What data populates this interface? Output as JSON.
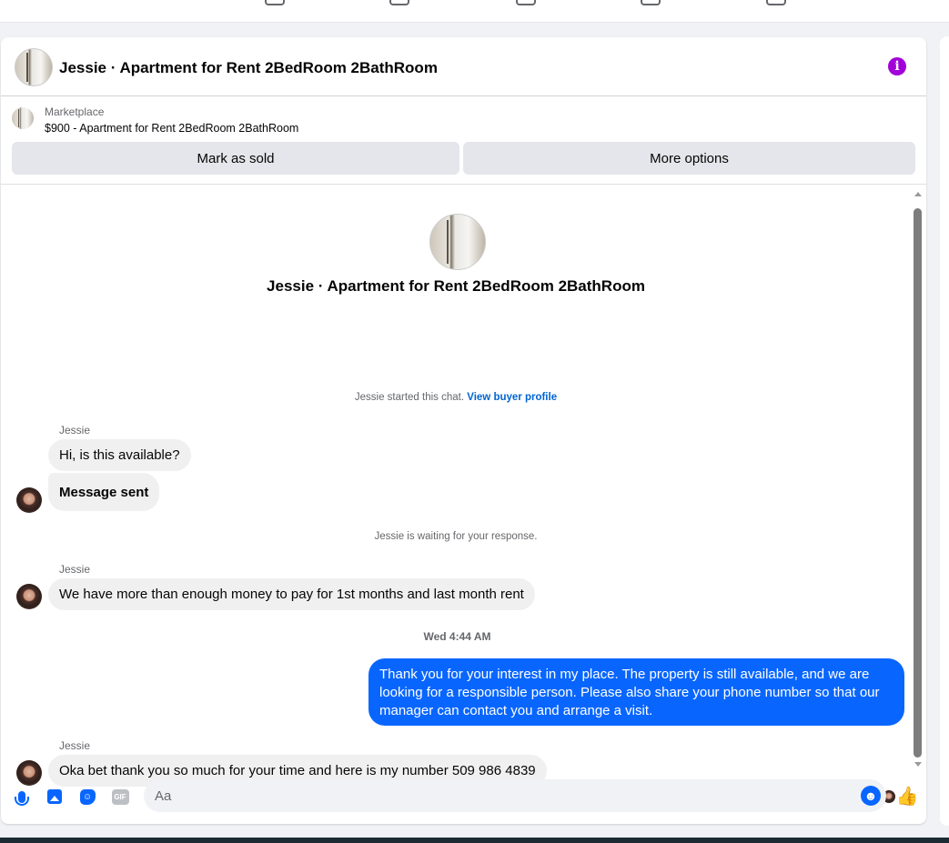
{
  "header": {
    "title": "Jessie · Apartment for Rent 2BedRoom 2BathRoom",
    "info_icon": "info-icon"
  },
  "marketplace": {
    "label": "Marketplace",
    "listing": "$900 - Apartment for Rent 2BedRoom 2BathRoom",
    "buttons": {
      "mark_sold": "Mark as sold",
      "more_options": "More options"
    }
  },
  "chat": {
    "intro_title": "Jessie · Apartment for Rent 2BedRoom 2BathRoom",
    "started_text": "Jessie started this chat.",
    "view_buyer_profile": "View buyer profile",
    "waiting_text": "Jessie is waiting for your response.",
    "timestamp": "Wed 4:44 AM",
    "messages": [
      {
        "sender": "Jessie",
        "text": "Hi, is this available?"
      },
      {
        "text": "Message sent"
      },
      {
        "sender": "Jessie",
        "text": "We have more than enough money to pay for 1st months and last month rent"
      },
      {
        "text": "Thank you for your interest in my place. The property is still available, and we are looking for a responsible person. Please also share your phone number so that our manager can contact you and arrange a visit."
      },
      {
        "sender": "Jessie",
        "text": "Oka bet thank you so much for your time and here is my number 509 986 4839"
      }
    ]
  },
  "composer": {
    "placeholder": "Aa",
    "icons": [
      "microphone-icon",
      "photo-icon",
      "sticker-icon",
      "gif-icon",
      "emoji-icon",
      "like-icon"
    ],
    "gif_text": "GIF"
  },
  "colors": {
    "accent_blue": "#0866ff",
    "info_purple": "#a100d9",
    "link_blue": "#0064d1",
    "incoming_bubble": "#f0f0f0"
  }
}
